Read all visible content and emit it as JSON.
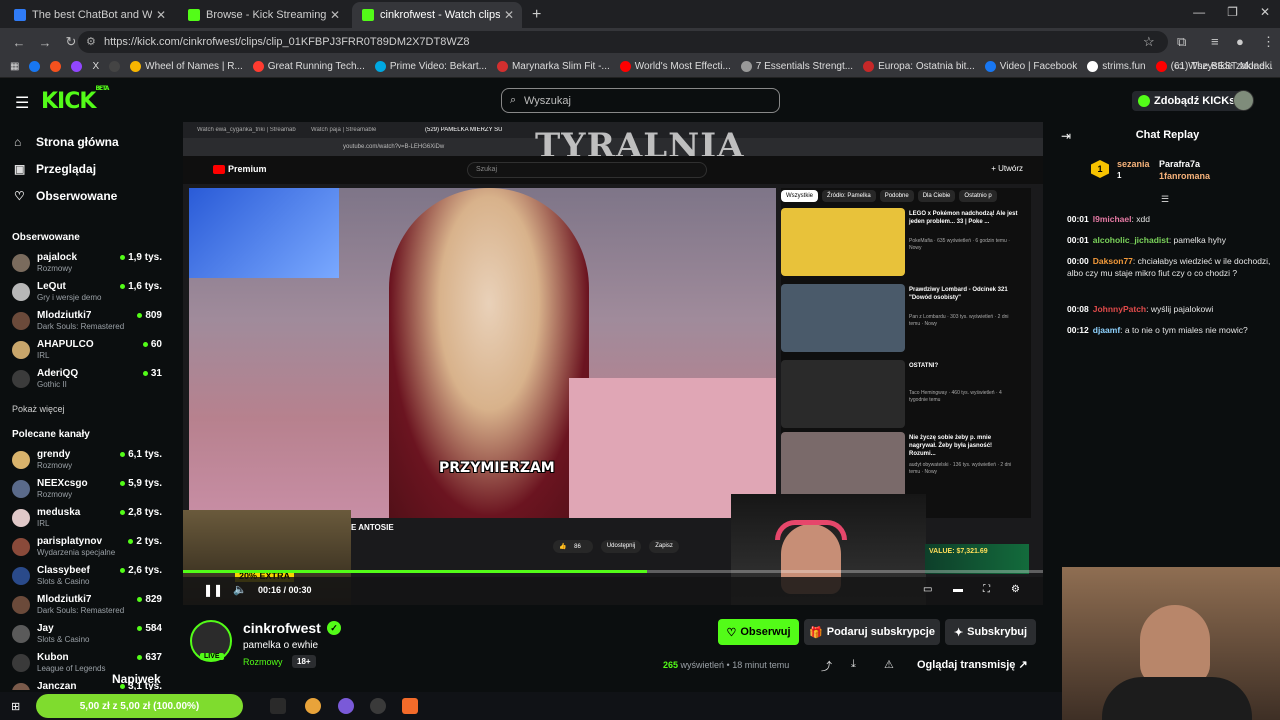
{
  "browser": {
    "tabs": [
      {
        "title": "The best ChatBot and Widgets",
        "color": "#2f7bf6"
      },
      {
        "title": "Browse - Kick Streaming",
        "color": "#53fc18"
      },
      {
        "title": "cinkrofwest - Watch clips o",
        "color": "#53fc18"
      }
    ],
    "url": "https://kick.com/cinkrofwest/clips/clip_01KFBPJ3FRR0T89DM2X7DT8WZ8",
    "bookmarks": [
      {
        "label": "",
        "color": "#1877f2"
      },
      {
        "label": "",
        "color": "#f4511e"
      },
      {
        "label": "",
        "color": "#9146ff"
      },
      {
        "label": "X",
        "color": "#ffffff"
      },
      {
        "label": "",
        "color": "#444"
      },
      {
        "label": "Wheel of Names | R...",
        "color": "#f7b500"
      },
      {
        "label": "Great Running Tech...",
        "color": "#ff3b30"
      },
      {
        "label": "Prime Video: Bekart...",
        "color": "#00a8e1"
      },
      {
        "label": "Marynarka Slim Fit -...",
        "color": "#d32f2f"
      },
      {
        "label": "World's Most Effecti...",
        "color": "#ff0000"
      },
      {
        "label": "7 Essentials Strengt...",
        "color": "#999"
      },
      {
        "label": "Europa: Ostatnia bit...",
        "color": "#c62828"
      },
      {
        "label": "Video | Facebook",
        "color": "#1877f2"
      },
      {
        "label": "strims.fun",
        "color": "#ffffff"
      },
      {
        "label": "(61) The BEST Mone...",
        "color": "#ff0000"
      }
    ],
    "bookmarks_right": "Wszystkie zakładki"
  },
  "header": {
    "logo": "KICK",
    "logo_sup": "BETA",
    "search_placeholder": "Wyszukaj",
    "kicks_button": "Zdobądź KICKs"
  },
  "sidebar": {
    "nav": [
      {
        "label": "Strona główna",
        "icon": "home-icon"
      },
      {
        "label": "Przeglądaj",
        "icon": "browse-icon"
      },
      {
        "label": "Obserwowane",
        "icon": "heart-icon"
      }
    ],
    "followed_heading": "Obserwowane",
    "followed": [
      {
        "name": "pajalock",
        "category": "Rozmowy",
        "viewers": "1,9 tys.",
        "color": "#7a6b5d"
      },
      {
        "name": "LeQut",
        "category": "Gry i wersje demo",
        "viewers": "1,6 tys.",
        "color": "#b7b7b7"
      },
      {
        "name": "Mlodziutki7",
        "category": "Dark Souls: Remastered",
        "viewers": "809",
        "color": "#6b4a3a"
      },
      {
        "name": "AHAPULCO",
        "category": "IRL",
        "viewers": "60",
        "color": "#c9a66b"
      },
      {
        "name": "AderiQQ",
        "category": "Gothic II",
        "viewers": "31",
        "color": "#3b3b3b"
      }
    ],
    "show_more": "Pokaż więcej",
    "recommended_heading": "Polecane kanały",
    "recommended": [
      {
        "name": "grendy",
        "category": "Rozmowy",
        "viewers": "6,1 tys.",
        "color": "#d9b36c"
      },
      {
        "name": "NEEXcsgo",
        "category": "Rozmowy",
        "viewers": "5,9 tys.",
        "color": "#5a6a8a"
      },
      {
        "name": "meduska",
        "category": "IRL",
        "viewers": "2,8 tys.",
        "color": "#e0c8c8"
      },
      {
        "name": "parisplatynov",
        "category": "Wydarzenia specjalne",
        "viewers": "2 tys.",
        "color": "#8a4a3a"
      },
      {
        "name": "Classybeef",
        "category": "Slots & Casino",
        "viewers": "2,6 tys.",
        "color": "#2a4a8a"
      },
      {
        "name": "Mlodziutki7",
        "category": "Dark Souls: Remastered",
        "viewers": "829",
        "color": "#6b4a3a"
      },
      {
        "name": "Jay",
        "category": "Slots & Casino",
        "viewers": "584",
        "color": "#5a5a5a"
      },
      {
        "name": "Kubon",
        "category": "League of Legends",
        "viewers": "637",
        "color": "#3a3a3a"
      },
      {
        "name": "Janczan",
        "category": "",
        "viewers": "3,1 tys.",
        "color": "#7a5a4a"
      }
    ]
  },
  "player": {
    "inner_tabs": [
      "Watch ewa_cyganka_triki | Streamab",
      "Watch paja | Streamable",
      "(529) PAMELKA MIERZY SU"
    ],
    "inner_url": "youtube.com/watch?v=B-LEHG6XiDw",
    "overlay_title": "TYRALNIA",
    "yt_logo": "Premium",
    "yt_search": "Szukaj",
    "yt_create": "+ Utwórz",
    "caption": "PRZYMIERZAM",
    "chips": [
      "Wszystkie",
      "Źródło: Pamelka",
      "Podobne",
      "Dla Ciebie",
      "Ostatnio p"
    ],
    "recs": [
      {
        "title": "LEGO x Pokémon nadchodzą! Ale jest jeden problem... 33 | Poke ...",
        "meta": "PokeMafia · 635 wyświetleń · 6 godzin temu · Nowy",
        "color": "#e8c23a"
      },
      {
        "title": "Prawdziwy Lombard - Odcinek 321 \"Dowód osobisty\"",
        "meta": "Pan z Lombardu · 303 tys. wyświetleń · 2 dni temu · Nowy",
        "color": "#4a5a6a"
      },
      {
        "title": "OSTATNI?",
        "meta": "Taco Hemingway · 460 tys. wyświetleń · 4 tygodnie temu",
        "color": "#2a2a2a"
      },
      {
        "title": "Nie życzę sobie żeby p. mnie nagrywał. Żeby była jasność! Rozumi...",
        "meta": "audyt obywatelski · 136 tys. wyświetleń · 2 dni temu · Nowy",
        "color": "#7a6a6a"
      }
    ],
    "bottom_title": "E ANTOSIE",
    "likes": "86",
    "share": "Udostępnij",
    "save": "Zapisz",
    "extra": "20% EXTRA",
    "time": "00:16 / 00:30",
    "progress_fraction": 0.54,
    "promo": "VALUE: $7,321.69"
  },
  "channel": {
    "name": "cinkrofwest",
    "live": "LIVE",
    "title": "pamelka o ewhie",
    "category": "Rozmowy",
    "age": "18+",
    "follow": "Obserwuj",
    "gift": "Podaruj subskrypcje",
    "subscribe": "Subskrybuj",
    "views_count": "265",
    "views_label": "wyświetleń • 18 minut temu",
    "watch_stream": "Oglądaj transmisję"
  },
  "chat": {
    "title": "Chat Replay",
    "top_gifter": {
      "name": "sezania",
      "count": "1",
      "rank": "1"
    },
    "gifter2": "Parafra7a",
    "gifter3": "1fanromana",
    "messages": [
      {
        "time": "00:01",
        "user": "l9michael",
        "text": "xdd",
        "color": "#e67aa4"
      },
      {
        "time": "00:01",
        "user": "alcoholic_jichadist",
        "text": "pamelka hyhy",
        "color": "#7bd35b"
      },
      {
        "time": "00:00",
        "user": "Dakson77",
        "text": "chciałabys wiedzieć w ile dochodzi, albo czy mu staje mikro fiut czy o co chodzi ?",
        "color": "#f39a3b"
      },
      {
        "time": "00:08",
        "user": "JohnnyPatch",
        "text": "wyślij pajalokowi",
        "color": "#e14b4b"
      },
      {
        "time": "00:12",
        "user": "djaamf",
        "text": "a to nie o tym miales nie mowic?",
        "color": "#8fd3ff"
      }
    ]
  },
  "taskbar": {
    "donation": "5,00 zł z 5,00 zł (100.00%)",
    "tip_label": "Napiwek"
  }
}
